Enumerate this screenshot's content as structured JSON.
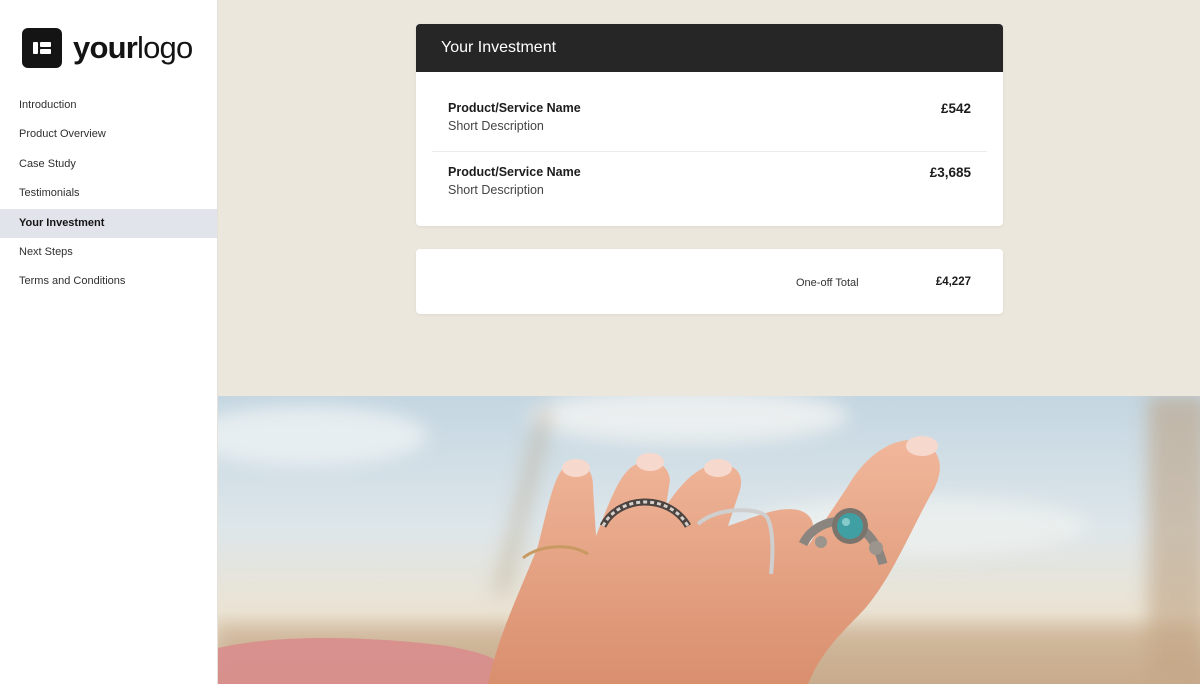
{
  "brand": {
    "logo_bold": "your",
    "logo_regular": "logo"
  },
  "nav": {
    "items": [
      {
        "label": "Introduction"
      },
      {
        "label": "Product Overview"
      },
      {
        "label": "Case Study"
      },
      {
        "label": "Testimonials"
      },
      {
        "label": "Your Investment"
      },
      {
        "label": "Next Steps"
      },
      {
        "label": "Terms and Conditions"
      }
    ],
    "active_index": 4
  },
  "investment": {
    "title": "Your Investment",
    "items": [
      {
        "name": "Product/Service Name",
        "description": "Short Description",
        "price": "£542"
      },
      {
        "name": "Product/Service Name",
        "description": "Short Description",
        "price": "£3,685"
      }
    ],
    "total_label": "One-off Total",
    "total_value": "£4,227"
  },
  "colors": {
    "page_background": "#ebe7dd",
    "header_background": "#262626",
    "active_nav_background": "#e1e4ea"
  }
}
